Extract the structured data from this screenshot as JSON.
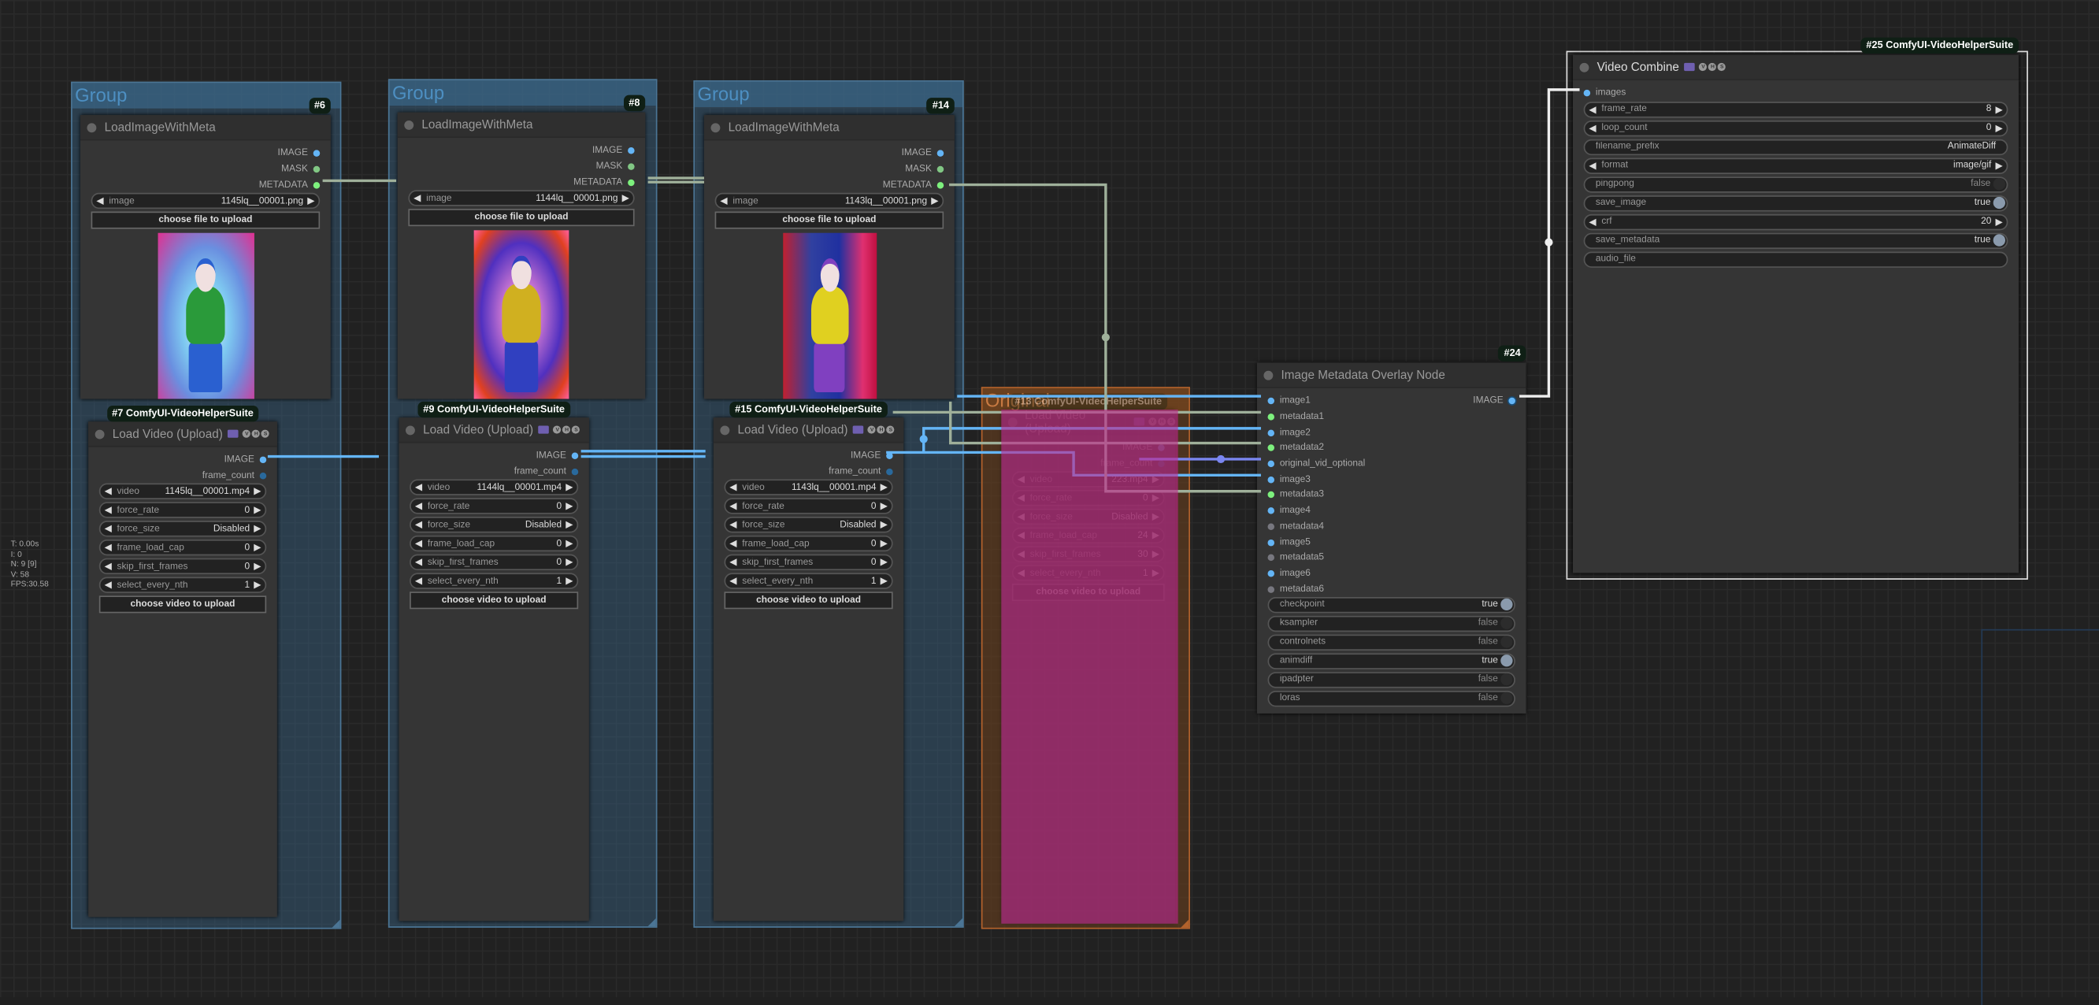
{
  "stats": [
    "T: 0.00s",
    "I: 0",
    "N: 9 [9]",
    "V: 58",
    "FPS:30.58"
  ],
  "slot_colors": {
    "IMAGE": "#64b5f6",
    "MASK": "#81c784",
    "METADATA": "#7df07d",
    "INT": "#29699c",
    "NONE": "#77777f"
  },
  "toggle_colors": {
    "on": "#8a9aac",
    "off": "#2c2c2c"
  },
  "link_colors": {
    "image": "#64b5f6",
    "metadata": "#9fb09a",
    "output": "#eeeeee",
    "video": "#7a86f0"
  },
  "groups": [
    {
      "title": "Group"
    },
    {
      "title": "Group"
    },
    {
      "title": "Group"
    },
    {
      "title": "Original"
    }
  ],
  "nodes": {
    "n6": {
      "badge": "#6",
      "title": "LoadImageWithMeta",
      "outputs": [
        {
          "name": "IMAGE",
          "type": "IMAGE"
        },
        {
          "name": "MASK",
          "type": "MASK"
        },
        {
          "name": "METADATA",
          "type": "METADATA"
        }
      ],
      "widgets": [
        {
          "kind": "combo",
          "label": "image",
          "value": "1145lq__00001.png"
        }
      ],
      "button": "choose file to upload"
    },
    "n7": {
      "badge": "#7 ComfyUI-VideoHelperSuite",
      "title": "Load Video (Upload)",
      "vhs": [
        "V",
        "H",
        "S"
      ],
      "outputs": [
        {
          "name": "IMAGE",
          "type": "IMAGE"
        },
        {
          "name": "frame_count",
          "type": "INT"
        }
      ],
      "widgets": [
        {
          "kind": "combo",
          "label": "video",
          "value": "1145lq__00001.mp4"
        },
        {
          "kind": "combo",
          "label": "force_rate",
          "value": "0"
        },
        {
          "kind": "combo",
          "label": "force_size",
          "value": "Disabled"
        },
        {
          "kind": "combo",
          "label": "frame_load_cap",
          "value": "0"
        },
        {
          "kind": "combo",
          "label": "skip_first_frames",
          "value": "0"
        },
        {
          "kind": "combo",
          "label": "select_every_nth",
          "value": "1"
        }
      ],
      "button": "choose video to upload"
    },
    "n8": {
      "badge": "#8",
      "title": "LoadImageWithMeta",
      "outputs": [
        {
          "name": "IMAGE",
          "type": "IMAGE"
        },
        {
          "name": "MASK",
          "type": "MASK"
        },
        {
          "name": "METADATA",
          "type": "METADATA"
        }
      ],
      "widgets": [
        {
          "kind": "combo",
          "label": "image",
          "value": "1144lq__00001.png"
        }
      ],
      "button": "choose file to upload"
    },
    "n9": {
      "badge": "#9 ComfyUI-VideoHelperSuite",
      "title": "Load Video (Upload)",
      "vhs": [
        "V",
        "H",
        "S"
      ],
      "outputs": [
        {
          "name": "IMAGE",
          "type": "IMAGE"
        },
        {
          "name": "frame_count",
          "type": "INT"
        }
      ],
      "widgets": [
        {
          "kind": "combo",
          "label": "video",
          "value": "1144lq__00001.mp4"
        },
        {
          "kind": "combo",
          "label": "force_rate",
          "value": "0"
        },
        {
          "kind": "combo",
          "label": "force_size",
          "value": "Disabled"
        },
        {
          "kind": "combo",
          "label": "frame_load_cap",
          "value": "0"
        },
        {
          "kind": "combo",
          "label": "skip_first_frames",
          "value": "0"
        },
        {
          "kind": "combo",
          "label": "select_every_nth",
          "value": "1"
        }
      ],
      "button": "choose video to upload"
    },
    "n14": {
      "badge": "#14",
      "title": "LoadImageWithMeta",
      "outputs": [
        {
          "name": "IMAGE",
          "type": "IMAGE"
        },
        {
          "name": "MASK",
          "type": "MASK"
        },
        {
          "name": "METADATA",
          "type": "METADATA"
        }
      ],
      "widgets": [
        {
          "kind": "combo",
          "label": "image",
          "value": "1143lq__00001.png"
        }
      ],
      "button": "choose file to upload"
    },
    "n15": {
      "badge": "#15 ComfyUI-VideoHelperSuite",
      "title": "Load Video (Upload)",
      "vhs": [
        "V",
        "H",
        "S"
      ],
      "outputs": [
        {
          "name": "IMAGE",
          "type": "IMAGE"
        },
        {
          "name": "frame_count",
          "type": "INT"
        }
      ],
      "widgets": [
        {
          "kind": "combo",
          "label": "video",
          "value": "1143lq__00001.mp4"
        },
        {
          "kind": "combo",
          "label": "force_rate",
          "value": "0"
        },
        {
          "kind": "combo",
          "label": "force_size",
          "value": "Disabled"
        },
        {
          "kind": "combo",
          "label": "frame_load_cap",
          "value": "0"
        },
        {
          "kind": "combo",
          "label": "skip_first_frames",
          "value": "0"
        },
        {
          "kind": "combo",
          "label": "select_every_nth",
          "value": "1"
        }
      ],
      "button": "choose video to upload"
    },
    "n13": {
      "badge": "#13 ComfyUI-VideoHelperSuite",
      "title": "Load Video (Upload)",
      "vhs": [
        "V",
        "H",
        "S"
      ],
      "outputs": [
        {
          "name": "IMAGE",
          "type": "IMAGE"
        },
        {
          "name": "frame_count",
          "type": "INT"
        }
      ],
      "widgets": [
        {
          "kind": "combo",
          "label": "video",
          "value": "223.mp4"
        },
        {
          "kind": "combo",
          "label": "force_rate",
          "value": "0"
        },
        {
          "kind": "combo",
          "label": "force_size",
          "value": "Disabled"
        },
        {
          "kind": "combo",
          "label": "frame_load_cap",
          "value": "24"
        },
        {
          "kind": "combo",
          "label": "skip_first_frames",
          "value": "30"
        },
        {
          "kind": "combo",
          "label": "select_every_nth",
          "value": "1"
        }
      ],
      "button": "choose video to upload"
    },
    "n24": {
      "badge": "#24",
      "title": "Image Metadata Overlay Node",
      "inputs": [
        {
          "name": "image1",
          "type": "IMAGE"
        },
        {
          "name": "metadata1",
          "type": "METADATA"
        },
        {
          "name": "image2",
          "type": "IMAGE"
        },
        {
          "name": "metadata2",
          "type": "METADATA"
        },
        {
          "name": "original_vid_optional",
          "type": "IMAGE"
        },
        {
          "name": "image3",
          "type": "IMAGE"
        },
        {
          "name": "metadata3",
          "type": "METADATA"
        },
        {
          "name": "image4",
          "type": "IMAGE"
        },
        {
          "name": "metadata4",
          "type": "NONE"
        },
        {
          "name": "image5",
          "type": "IMAGE"
        },
        {
          "name": "metadata5",
          "type": "NONE"
        },
        {
          "name": "image6",
          "type": "IMAGE"
        },
        {
          "name": "metadata6",
          "type": "NONE"
        }
      ],
      "outputs": [
        {
          "name": "IMAGE",
          "type": "IMAGE"
        }
      ],
      "widgets": [
        {
          "kind": "toggle",
          "label": "checkpoint",
          "value": "true"
        },
        {
          "kind": "toggle",
          "label": "ksampler",
          "value": "false"
        },
        {
          "kind": "toggle",
          "label": "controlnets",
          "value": "false"
        },
        {
          "kind": "toggle",
          "label": "animdiff",
          "value": "true"
        },
        {
          "kind": "toggle",
          "label": "ipadpter",
          "value": "false"
        },
        {
          "kind": "toggle",
          "label": "loras",
          "value": "false"
        }
      ]
    },
    "n25": {
      "badge": "#25 ComfyUI-VideoHelperSuite",
      "title": "Video Combine",
      "vhs": [
        "V",
        "H",
        "S"
      ],
      "inputs": [
        {
          "name": "images",
          "type": "IMAGE"
        }
      ],
      "widgets": [
        {
          "kind": "combo",
          "label": "frame_rate",
          "value": "8"
        },
        {
          "kind": "combo",
          "label": "loop_count",
          "value": "0"
        },
        {
          "kind": "text",
          "label": "filename_prefix",
          "value": "AnimateDiff"
        },
        {
          "kind": "combo",
          "label": "format",
          "value": "image/gif"
        },
        {
          "kind": "toggle",
          "label": "pingpong",
          "value": "false"
        },
        {
          "kind": "toggle",
          "label": "save_image",
          "value": "true"
        },
        {
          "kind": "combo",
          "label": "crf",
          "value": "20"
        },
        {
          "kind": "toggle",
          "label": "save_metadata",
          "value": "true"
        },
        {
          "kind": "text",
          "label": "audio_file",
          "value": ""
        }
      ]
    }
  }
}
